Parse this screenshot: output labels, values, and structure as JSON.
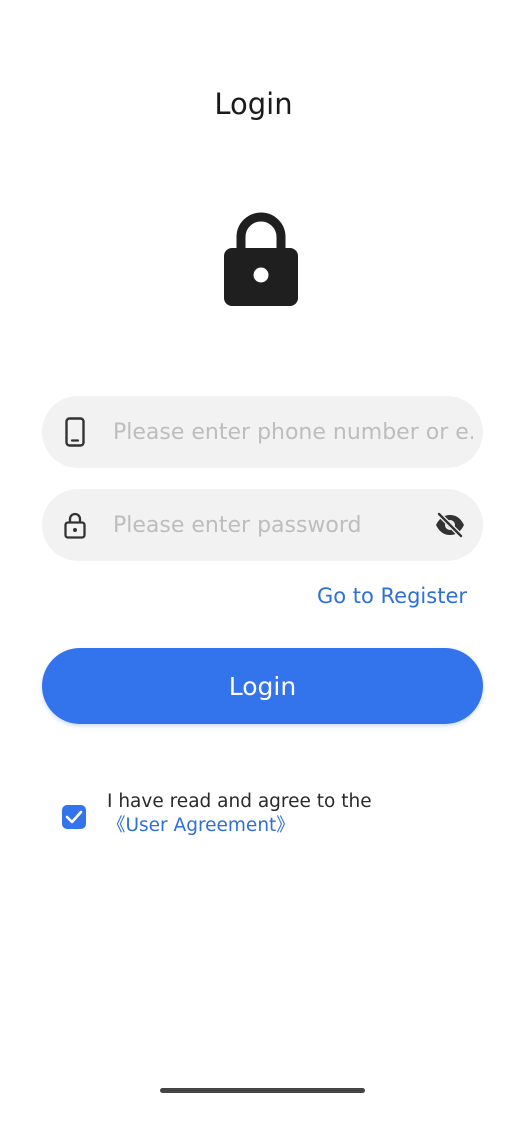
{
  "page": {
    "title": "Login"
  },
  "icons": {
    "hero": "lock-icon",
    "account": "phone-icon",
    "password": "lock-outline-icon",
    "visibility": "eye-off-icon",
    "checkbox": "check-icon"
  },
  "form": {
    "account": {
      "value": "",
      "placeholder": "Please enter phone number or e..."
    },
    "password": {
      "value": "",
      "placeholder": "Please enter password"
    },
    "register_link": "Go to Register",
    "login_button": "Login"
  },
  "agreement": {
    "checked": true,
    "text": "I have read and agree to the ",
    "link": "《User Agreement》"
  },
  "colors": {
    "accent": "#3374ed",
    "link": "#2e6fd8",
    "field_bg": "#f2f2f2",
    "placeholder": "#bdbdbd"
  }
}
